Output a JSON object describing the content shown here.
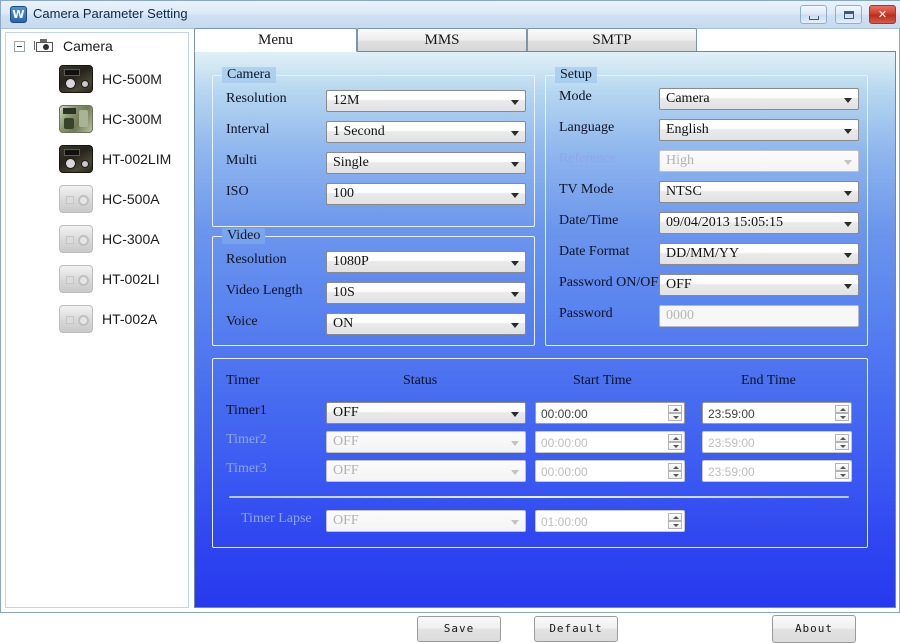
{
  "window": {
    "title": "Camera Parameter Setting",
    "icon": "app-logo-icon",
    "minimize_label": "–",
    "maximize_label": "□",
    "close_label": "✕"
  },
  "tree": {
    "root": {
      "label": "Camera",
      "icon": "camera-icon",
      "expander": "collapse-toggle"
    },
    "items": [
      {
        "label": "HC-500M",
        "thumb": "dark"
      },
      {
        "label": "HC-300M",
        "thumb": "tall"
      },
      {
        "label": "HT-002LIM",
        "thumb": "dark"
      },
      {
        "label": "HC-500A",
        "thumb": "grey"
      },
      {
        "label": "HC-300A",
        "thumb": "grey"
      },
      {
        "label": "HT-002LI",
        "thumb": "grey"
      },
      {
        "label": "HT-002A",
        "thumb": "grey"
      }
    ]
  },
  "tabs": [
    {
      "label": "Menu",
      "active": true
    },
    {
      "label": "MMS",
      "active": false
    },
    {
      "label": "SMTP",
      "active": false
    }
  ],
  "camera_group": {
    "legend": "Camera",
    "rows": [
      {
        "label": "Resolution",
        "value": "12M",
        "type": "combo",
        "disabled": false
      },
      {
        "label": "Interval",
        "value": "1  Second",
        "type": "combo",
        "disabled": false
      },
      {
        "label": "Multi",
        "value": "Single",
        "type": "combo",
        "disabled": false
      },
      {
        "label": "ISO",
        "value": "100",
        "type": "combo",
        "disabled": false
      }
    ]
  },
  "video_group": {
    "legend": "Video",
    "rows": [
      {
        "label": "Resolution",
        "value": "1080P",
        "type": "combo",
        "disabled": false
      },
      {
        "label": "Video Length",
        "value": "10S",
        "type": "combo",
        "disabled": false
      },
      {
        "label": "Voice",
        "value": "ON",
        "type": "combo",
        "disabled": false
      }
    ]
  },
  "setup_group": {
    "legend": "Setup",
    "rows": [
      {
        "label": "Mode",
        "value": "Camera",
        "type": "combo",
        "disabled": false
      },
      {
        "label": "Language",
        "value": "English",
        "type": "combo",
        "disabled": false
      },
      {
        "label": "Reference",
        "value": "High",
        "type": "combo",
        "disabled": true
      },
      {
        "label": "TV Mode",
        "value": "NTSC",
        "type": "combo",
        "disabled": false
      },
      {
        "label": "Date/Time",
        "value": "09/04/2013 15:05:15",
        "type": "combo",
        "disabled": false
      },
      {
        "label": "Date Format",
        "value": "DD/MM/YY",
        "type": "combo",
        "disabled": false
      },
      {
        "label": "Password ON/OFF",
        "value": "OFF",
        "type": "combo",
        "disabled": false
      },
      {
        "label": "Password",
        "value": "0000",
        "type": "text",
        "disabled": true
      }
    ]
  },
  "timer_group": {
    "headers": {
      "timer": "Timer",
      "status": "Status",
      "start_time": "Start Time",
      "end_time": "End Time"
    },
    "rows": [
      {
        "label": "Timer1",
        "status": "OFF",
        "start": "00:00:00",
        "end": "23:59:00",
        "disabled": false
      },
      {
        "label": "Timer2",
        "status": "OFF",
        "start": "00:00:00",
        "end": "23:59:00",
        "disabled": true
      },
      {
        "label": "Timer3",
        "status": "OFF",
        "start": "00:00:00",
        "end": "23:59:00",
        "disabled": true
      }
    ],
    "lapse": {
      "label": "Timer Lapse",
      "status": "OFF",
      "interval": "01:00:00",
      "disabled": true
    }
  },
  "buttons": {
    "save": "Save",
    "default": "Default",
    "about": "About"
  }
}
